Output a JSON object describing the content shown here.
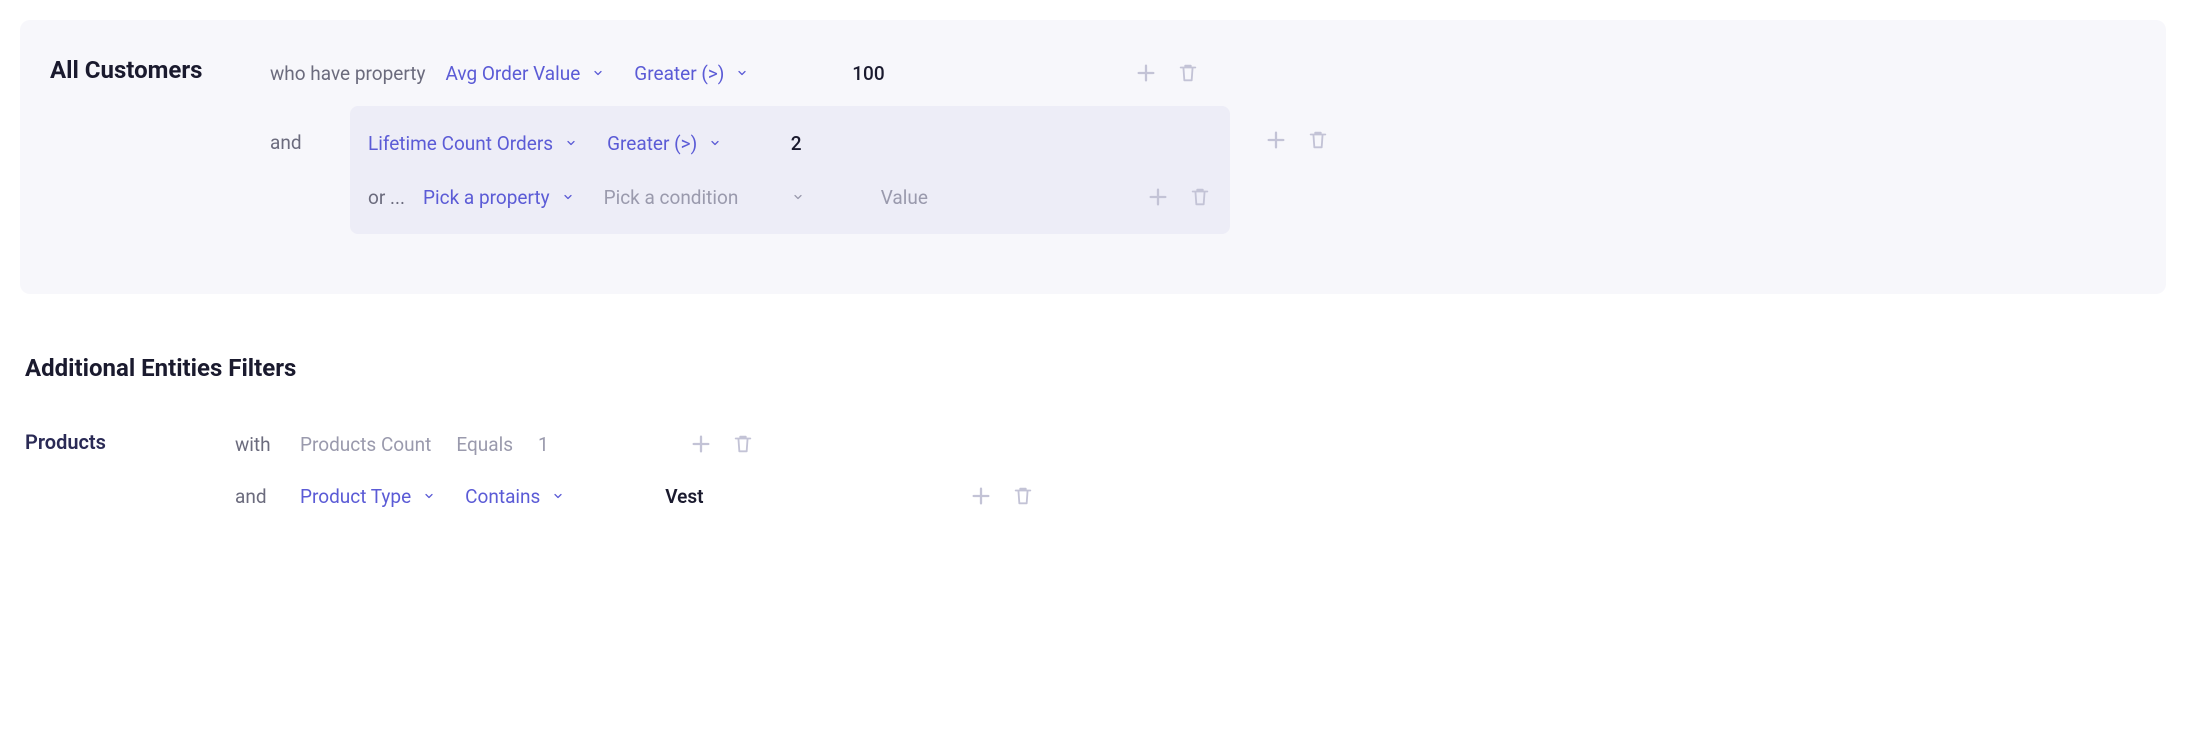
{
  "panel": {
    "entity_name": "All Customers",
    "condition_prefix": "who have property",
    "and_label": "and",
    "or_label": "or ...",
    "row1": {
      "property": "Avg Order Value",
      "operator": "Greater (>)",
      "value": "100"
    },
    "nested": {
      "row2": {
        "property": "Lifetime Count Orders",
        "operator": "Greater (>)",
        "value": "2"
      },
      "row3": {
        "property_placeholder": "Pick a property",
        "operator_placeholder": "Pick a condition",
        "value_placeholder": "Value"
      }
    }
  },
  "additional": {
    "title": "Additional Entities Filters",
    "products": {
      "entity_name": "Products",
      "with_label": "with",
      "and_label": "and",
      "row1": {
        "property": "Products Count",
        "operator": "Equals",
        "value": "1"
      },
      "row2": {
        "property": "Product Type",
        "operator": "Contains",
        "value": "Vest"
      }
    }
  }
}
